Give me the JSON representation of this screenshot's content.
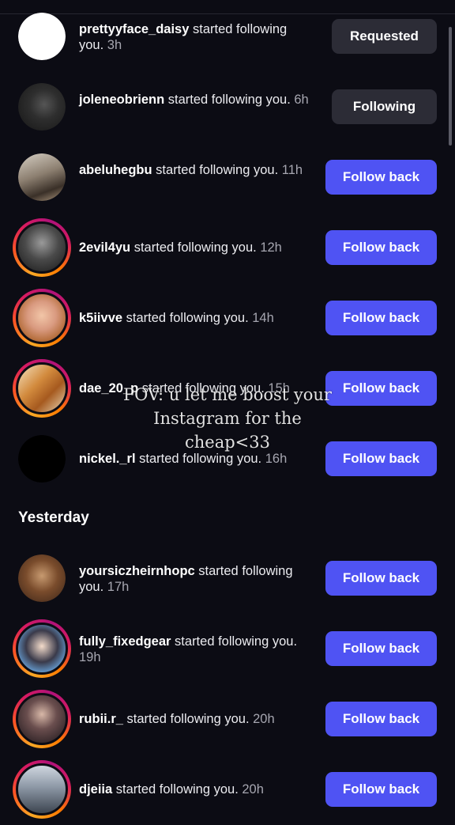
{
  "today": [
    {
      "username": "prettyyface_daisy",
      "action": " started following you.",
      "time": " 3h",
      "button": "Requested",
      "button_style": "secondary",
      "story_ring": false
    },
    {
      "username": "joleneobrienn",
      "action": " started following you.",
      "time": " 6h",
      "button": "Following",
      "button_style": "secondary",
      "story_ring": false
    },
    {
      "username": "abeluhegbu",
      "action": " started following you.",
      "time": " 11h",
      "button": "Follow back",
      "button_style": "primary",
      "story_ring": false
    },
    {
      "username": "2evil4yu",
      "action": " started following you.",
      "time": " 12h",
      "button": "Follow back",
      "button_style": "primary",
      "story_ring": true
    },
    {
      "username": "k5iivve",
      "action": " started following you.",
      "time": " 14h",
      "button": "Follow back",
      "button_style": "primary",
      "story_ring": true
    },
    {
      "username": "dae_20_p",
      "action": " started following you.",
      "time": " 15h",
      "button": "Follow back",
      "button_style": "primary",
      "story_ring": true
    },
    {
      "username": "nickel._rl",
      "action": " started following you.",
      "time": " 16h",
      "button": "Follow back",
      "button_style": "primary",
      "story_ring": false
    }
  ],
  "yesterday_section": {
    "title": "Yesterday"
  },
  "yesterday": [
    {
      "username": "yoursiczheirnhopc",
      "action": " started following you.",
      "time": " 17h",
      "button": "Follow back",
      "button_style": "primary",
      "story_ring": false
    },
    {
      "username": "fully_fixedgear",
      "action": " started following you.",
      "time": " 19h",
      "button": "Follow back",
      "button_style": "primary",
      "story_ring": true
    },
    {
      "username": "rubii.r_",
      "action": " started following you.",
      "time": " 20h",
      "button": "Follow back",
      "button_style": "primary",
      "story_ring": true
    },
    {
      "username": "djeiia",
      "action": " started following you.",
      "time": " 20h",
      "button": "Follow back",
      "button_style": "primary",
      "story_ring": true
    }
  ],
  "overlay_caption": {
    "line1": "POV: u let me boost your",
    "line2": "Instagram for the cheap<33"
  },
  "colors": {
    "background": "#0c0c14",
    "primary_button": "#4f53f3",
    "secondary_button": "#2c2c36",
    "story_ring": "#d81b60"
  },
  "icons": {
    "avatar": "avatar-icon"
  }
}
